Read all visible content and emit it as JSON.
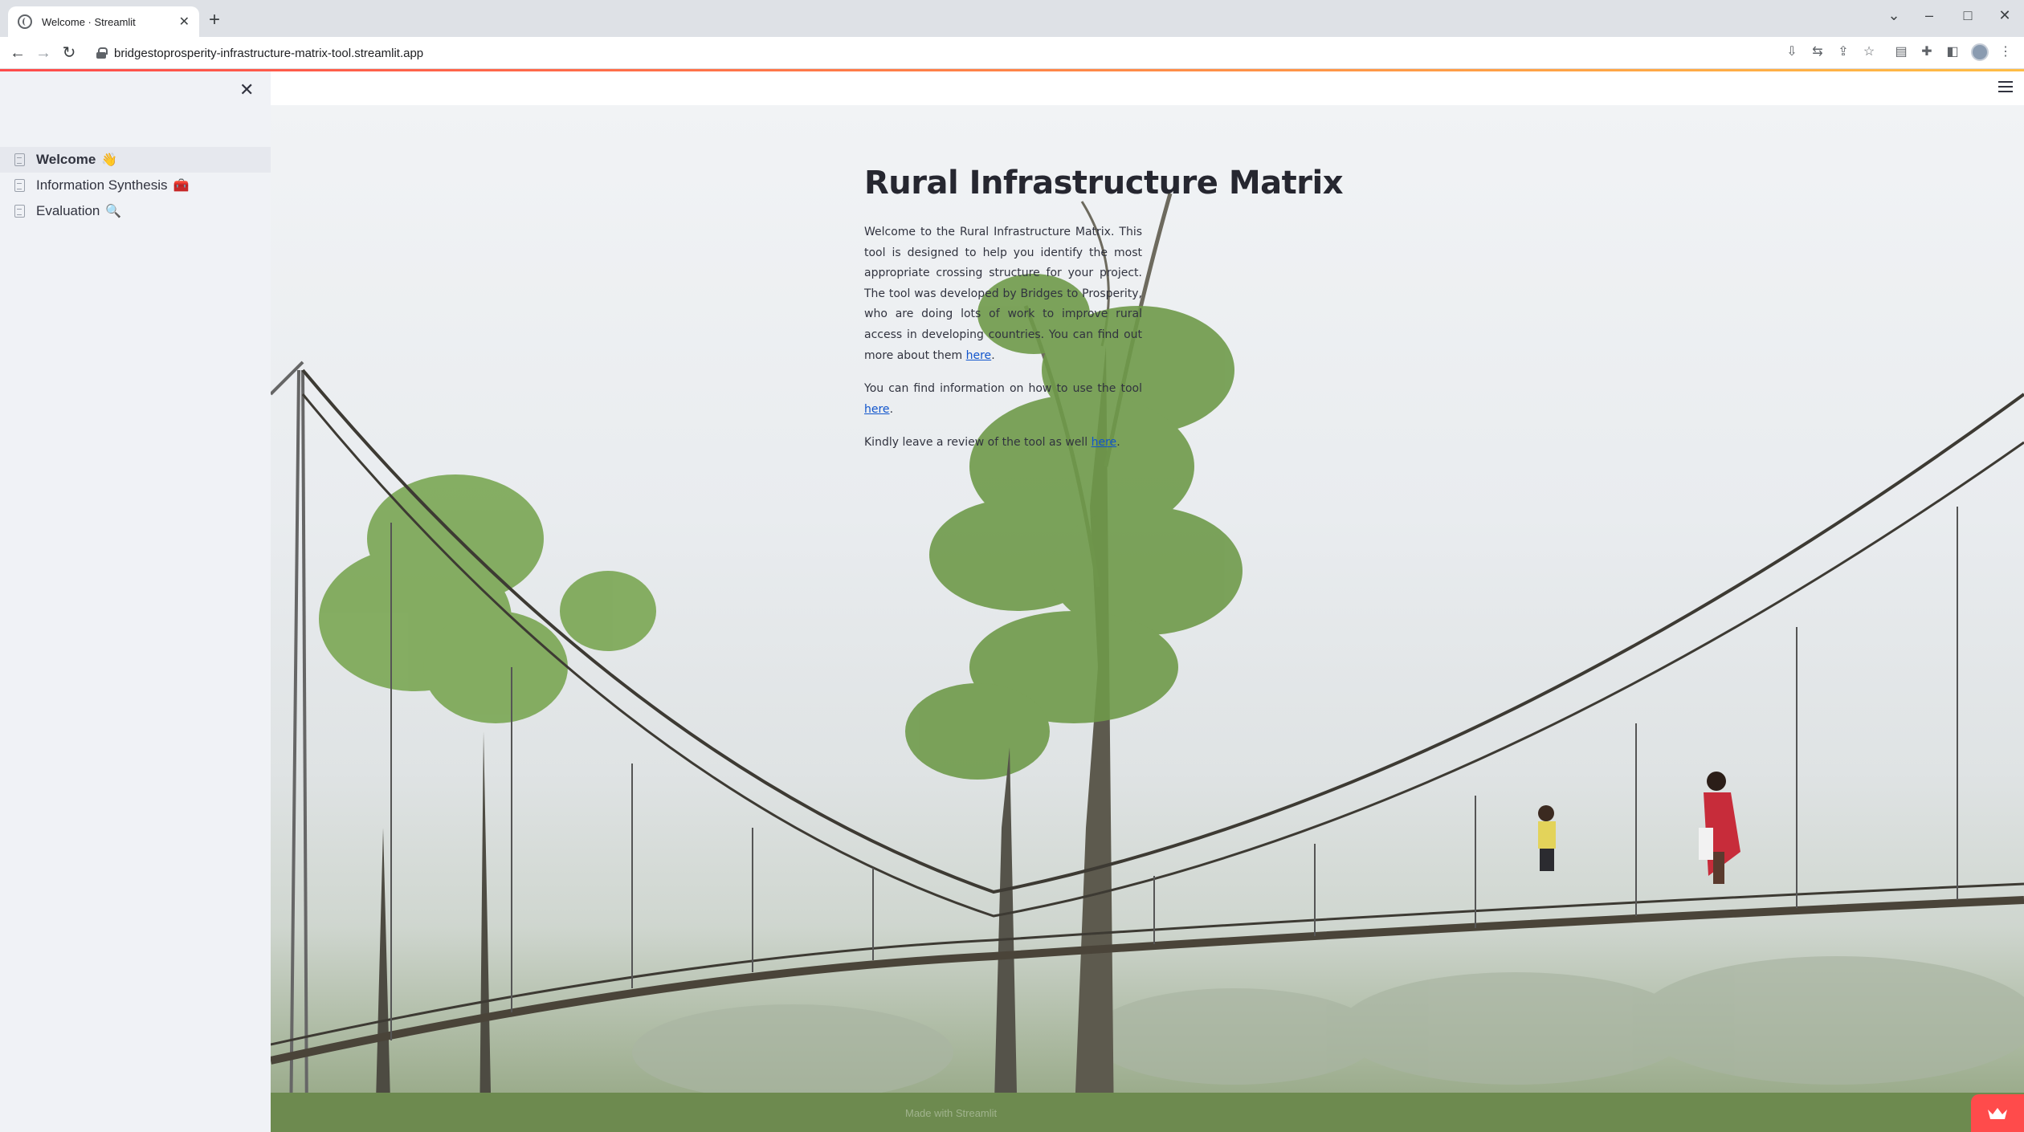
{
  "browser": {
    "tab_title": "Welcome · Streamlit",
    "tab_close": "✕",
    "new_tab": "+",
    "url": "bridgestoprosperity-infrastructure-matrix-tool.streamlit.app",
    "window_controls": {
      "tab_search": "⌄",
      "minimize": "–",
      "maximize": "□",
      "close": "✕"
    },
    "nav": {
      "back": "←",
      "forward": "→",
      "reload": "↻"
    }
  },
  "sidebar": {
    "close": "✕",
    "items": [
      {
        "label": "Welcome",
        "emoji": "👋",
        "active": true
      },
      {
        "label": "Information Synthesis",
        "emoji": "🧰",
        "active": false
      },
      {
        "label": "Evaluation",
        "emoji": "🔍",
        "active": false
      }
    ]
  },
  "main": {
    "title": "Rural Infrastructure Matrix",
    "p1_text": "Welcome to the Rural Infrastructure Matrix. This tool is designed to help you identify the most appropriate crossing structure for your project. The tool was developed by Bridges to Prosperity, who are doing lots of work to improve rural access in developing countries. You can find out more about them ",
    "p1_link": "here",
    "p2_text": "You can find information on how to use the tool ",
    "p2_link": "here",
    "p3_text": "Kindly leave a review of the tool as well ",
    "p3_link": "here",
    "period": "."
  },
  "footer": {
    "text": "Made with Streamlit"
  },
  "colors": {
    "accent": "#ff4b4b",
    "sidebar_bg": "#f0f2f6",
    "link": "#1155cc",
    "text": "#31333f"
  }
}
